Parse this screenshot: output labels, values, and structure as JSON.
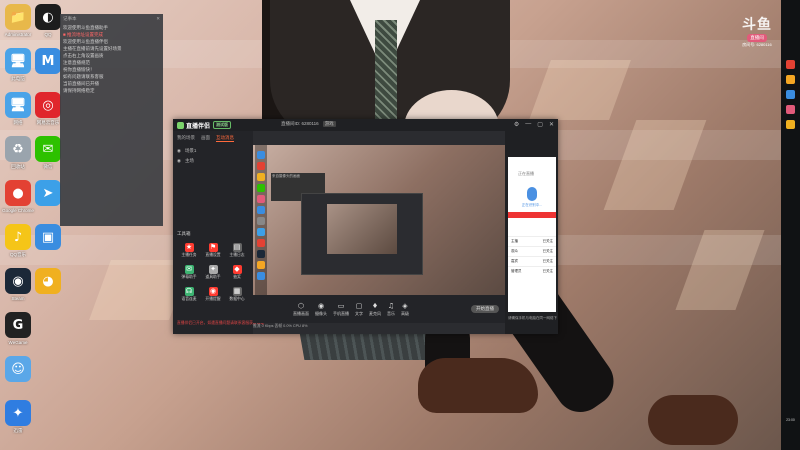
{
  "desktop": {
    "icons": [
      {
        "label": "Administrator",
        "glyph": "📁",
        "color": "#e8b84a",
        "icon": "folder-icon"
      },
      {
        "label": "此电脑",
        "glyph": "🖥",
        "color": "#4aa3e8",
        "icon": "computer-icon"
      },
      {
        "label": "网络",
        "glyph": "🖥",
        "color": "#4aa3e8",
        "icon": "network-icon"
      },
      {
        "label": "回收站",
        "glyph": "♻",
        "color": "#9aa4ad",
        "icon": "recycle-bin-icon"
      },
      {
        "label": "Google Chrome",
        "glyph": "●",
        "color": "#e34133",
        "icon": "chrome-icon"
      },
      {
        "label": "QQ音乐",
        "glyph": "♪",
        "color": "#f5c518",
        "icon": "qq-music-icon"
      },
      {
        "label": "Steam",
        "glyph": "◉",
        "color": "#1b2838",
        "icon": "steam-icon"
      },
      {
        "label": "WeGame",
        "glyph": "G",
        "color": "#222222",
        "icon": "wegame-icon"
      },
      {
        "label": "",
        "glyph": "☺",
        "color": "#5aa7e8",
        "icon": "assistant-icon"
      },
      {
        "label": "迅雷",
        "glyph": "✦",
        "color": "#2f7de1",
        "icon": "xunlei-icon"
      },
      {
        "label": "QQ",
        "glyph": "◐",
        "color": "#1d1d1d",
        "icon": "qq-icon"
      },
      {
        "label": "",
        "glyph": "M",
        "color": "#3a8de0",
        "icon": "meeting-icon"
      },
      {
        "label": "网易云音乐",
        "glyph": "◎",
        "color": "#e0262c",
        "icon": "netease-music-icon"
      },
      {
        "label": "微信",
        "glyph": "✉",
        "color": "#2dc100",
        "icon": "wechat-icon"
      },
      {
        "label": "",
        "glyph": "➤",
        "color": "#3ca0e8",
        "icon": "arrow-app-icon"
      },
      {
        "label": "",
        "glyph": "▣",
        "color": "#3a8de0",
        "icon": "display-icon"
      },
      {
        "label": "",
        "glyph": "◕",
        "color": "#f0b020",
        "icon": "mascot-icon"
      }
    ]
  },
  "notes": {
    "title": "记事本",
    "lines": [
      "欢迎使用斗鱼直播助手",
      "■ 推流地址设置完成",
      "欢迎使用斗鱼直播伴侣",
      "主播在直播前请先设置好场景",
      "点击右上角设置画质",
      "注意直播规范",
      "祝你直播愉快！",
      "如有问题请联系客服",
      "",
      "当前直播间已开播",
      "请保持网络稳定"
    ],
    "red_index": 1
  },
  "app": {
    "name": "直播伴侣",
    "badge": "测试版",
    "room": "直播间ID: 6280116",
    "tag": "游戏",
    "window_controls": [
      "⚙",
      "—",
      "▢",
      "✕"
    ],
    "left_tabs": [
      "我的场景",
      "画面",
      "互动消息"
    ],
    "active_tab": 2,
    "scenes": [
      "场景1",
      "主场"
    ],
    "tools_title": "工具箱",
    "tools": [
      {
        "label": "主播任务",
        "glyph": "★",
        "color": "#ff3b30"
      },
      {
        "label": "直播设置",
        "glyph": "⚑",
        "color": "#ff3b30"
      },
      {
        "label": "主播日志",
        "glyph": "▤",
        "color": "#666"
      },
      {
        "label": "弹幕助手",
        "glyph": "✉",
        "color": "#3cb371"
      },
      {
        "label": "道具助手",
        "glyph": "✦",
        "color": "#aaa"
      },
      {
        "label": "抽奖",
        "glyph": "◆",
        "color": "#ff3b30"
      },
      {
        "label": "语音连麦",
        "glyph": "☊",
        "color": "#3cb371"
      },
      {
        "label": "开播提醒",
        "glyph": "◉",
        "color": "#ff3b30"
      },
      {
        "label": "数据中心",
        "glyph": "▦",
        "color": "#666"
      }
    ],
    "tip": "直播伴侣已开启，如遇直播问题请联系客服获取帮助",
    "bottom_buttons": [
      {
        "label": "直播画面",
        "glyph": "⬡"
      },
      {
        "label": "摄像头",
        "glyph": "◉"
      },
      {
        "label": "手机直播",
        "glyph": "▭"
      },
      {
        "label": "文字",
        "glyph": "▢"
      },
      {
        "label": "麦克风",
        "glyph": "♦"
      },
      {
        "label": "音乐",
        "glyph": "♫"
      },
      {
        "label": "高级",
        "glyph": "◈"
      }
    ],
    "start_label": "开始直播",
    "status": "推流 0 Kbps  丢帧 0.0%  CPU 8%",
    "cam_text": "来自摄像头的画面",
    "phone": {
      "top": "正在直播",
      "caption": "正在识别中...",
      "list": [
        [
          "主播",
          "已关注"
        ],
        [
          "观众",
          "已关注"
        ],
        [
          "嘉宾",
          "已关注"
        ],
        [
          "管理员",
          "已关注"
        ]
      ]
    },
    "right_footer": "请确保手机与电脑在同一网络下"
  },
  "watermark": {
    "big": "斗鱼",
    "pill": "直播间",
    "room": "房间号: 6280116"
  },
  "taskbar": {
    "icons": [
      {
        "color": "#e34133"
      },
      {
        "color": "#f5a623"
      },
      {
        "color": "#3a8de0"
      },
      {
        "color": "#e25a7a"
      },
      {
        "color": "#f0b020"
      }
    ],
    "clock": "23:00"
  }
}
